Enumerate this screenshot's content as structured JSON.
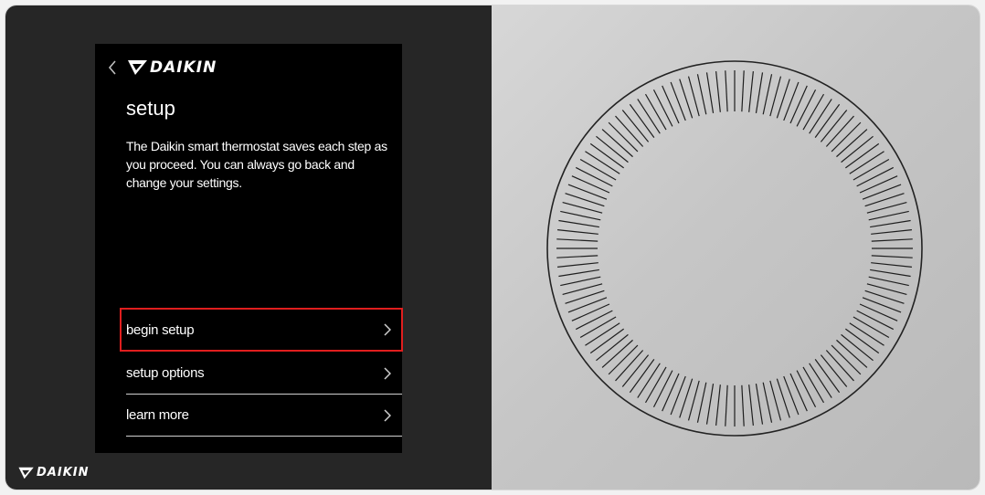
{
  "brand": {
    "name": "DAIKIN"
  },
  "screen": {
    "title": "setup",
    "description": "The Daikin smart thermostat saves each step as you proceed. You can always go back and change your settings.",
    "menu": [
      {
        "label": "begin setup",
        "highlighted": true
      },
      {
        "label": "setup options",
        "highlighted": false
      },
      {
        "label": "learn more",
        "highlighted": false
      }
    ]
  },
  "icons": {
    "back": "chevron-left-icon",
    "row": "chevron-right-icon",
    "logo": "daikin-logo-icon"
  },
  "colors": {
    "panel": "#262626",
    "screen": "#000000",
    "highlight": "#e01e1e",
    "dial_background": "#c6c6c6"
  },
  "dial": {
    "tick_count": 120
  }
}
